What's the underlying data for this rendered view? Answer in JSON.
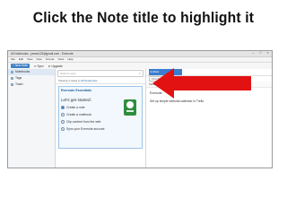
{
  "caption": "Click the Note title to highlight it",
  "window": {
    "title": "All Notebooks - james123@gmail.com - Evernote",
    "controls": [
      "–",
      "□",
      "×"
    ]
  },
  "menu": [
    "File",
    "Edit",
    "View",
    "Note",
    "Format",
    "Tools",
    "Help"
  ],
  "toolbar": {
    "new_note": "New Note",
    "sync": "Sync",
    "upgrade": "Upgrade"
  },
  "sidebar": {
    "items": [
      {
        "label": "Notebooks"
      },
      {
        "label": "Tags"
      },
      {
        "label": "Trash"
      }
    ]
  },
  "notelist": {
    "search_placeholder": "Search notes",
    "filter_prefix": "Viewing 1 notes in",
    "filter_value": "All Notebooks",
    "card": {
      "title": "Evernote Essentials",
      "subtitle": "Let's get started:",
      "checklist": [
        {
          "label": "Create a note",
          "done": true
        },
        {
          "label": "Create a notebook",
          "done": false
        },
        {
          "label": "Clip content from the web",
          "done": false
        },
        {
          "label": "Sync your Evernote account",
          "done": false
        }
      ]
    }
  },
  "editor": {
    "title_value": "Untitled",
    "notebook": "First Notebook",
    "tag_hint": "Click to add tag...",
    "format_font": "Tahoma",
    "format_size": "10",
    "body_lines": [
      "Evernote:",
      "Set up simple editorial calendar in Trello."
    ]
  },
  "colors": {
    "arrow": "#e31212",
    "accent": "#3b7ed0"
  }
}
